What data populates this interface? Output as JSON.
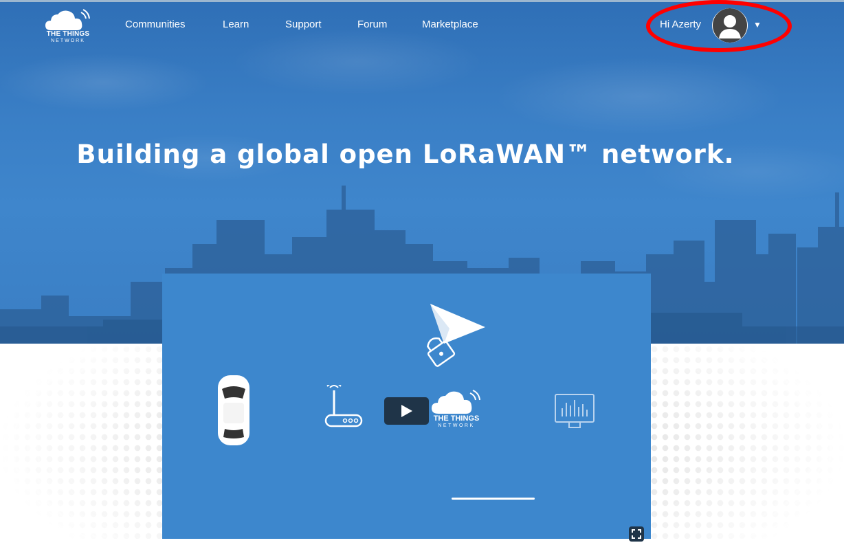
{
  "logo": {
    "line1": "THE THINGS",
    "line2": "NETWORK",
    "icon": "cloud-icon"
  },
  "nav": {
    "items": [
      {
        "label": "Communities"
      },
      {
        "label": "Learn"
      },
      {
        "label": "Support"
      },
      {
        "label": "Forum"
      },
      {
        "label": "Marketplace"
      }
    ]
  },
  "user": {
    "greeting": "Hi Azerty",
    "avatar_icon": "user-avatar-icon",
    "caret": "▼"
  },
  "hero": {
    "headline": "Building a global open LoRaWAN™ network."
  },
  "video": {
    "overlay_logo_line1": "THE THINGS",
    "overlay_logo_line2": "NETWORK",
    "icons": [
      "car-icon",
      "gateway-router-icon",
      "paper-plane-icon",
      "lock-icon",
      "cloud-icon",
      "dashboard-chart-icon"
    ],
    "play_icon": "play-icon",
    "fullscreen_icon": "fullscreen-icon"
  },
  "colors": {
    "hero_blue": "#3a7fc6",
    "video_blue": "#3d87cd",
    "play_button": "#1f3448",
    "annotation": "#ff0000"
  }
}
